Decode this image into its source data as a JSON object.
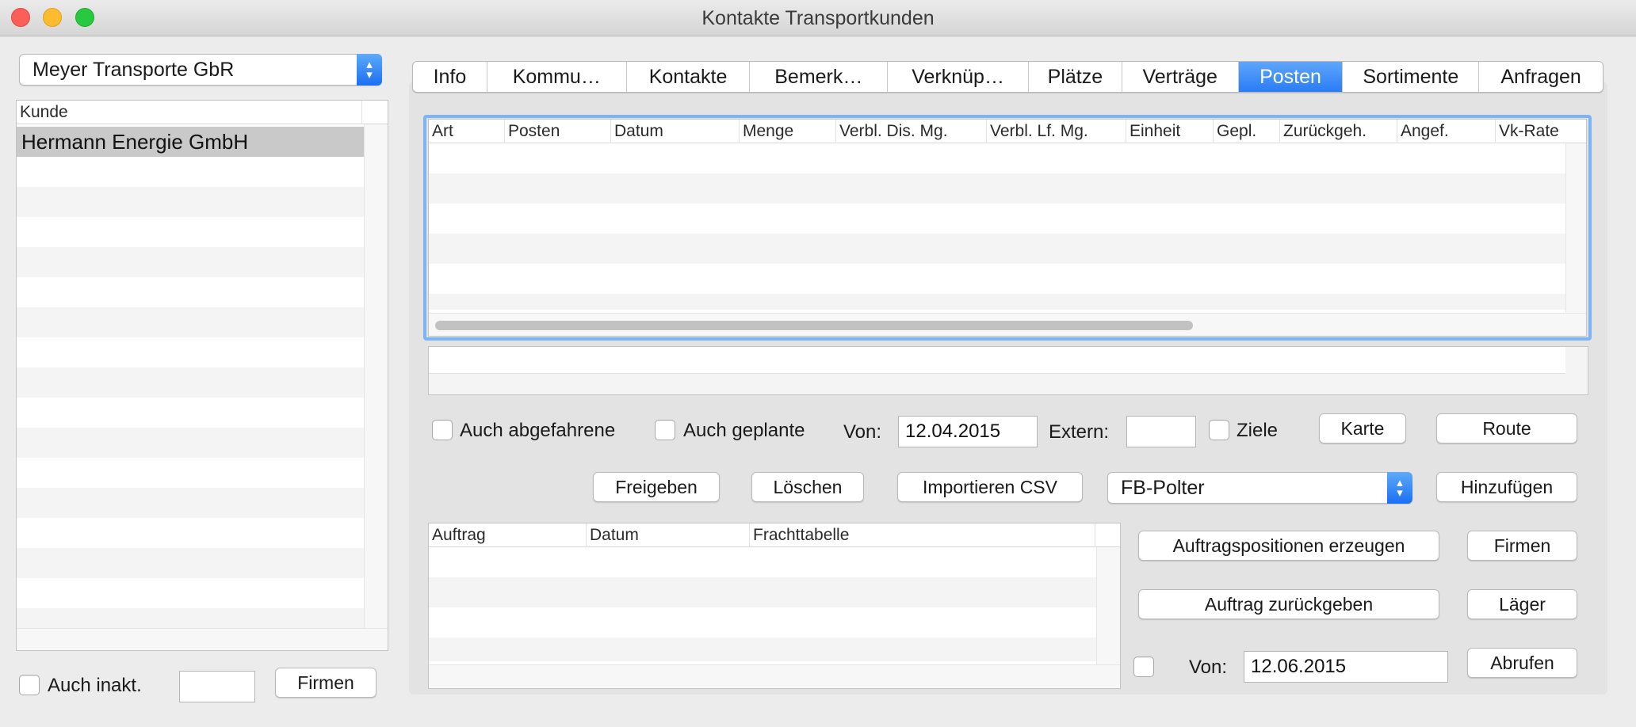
{
  "window": {
    "title": "Kontakte Transportkunden"
  },
  "company_select": {
    "value": "Meyer Transporte GbR"
  },
  "customer_list": {
    "header": "Kunde",
    "rows": [
      "Hermann Energie GmbH"
    ]
  },
  "left_footer": {
    "inactive_label": "Auch inakt.",
    "firms_button": "Firmen"
  },
  "tabs": [
    "Info",
    "Kommu…",
    "Kontakte",
    "Bemerk…",
    "Verknüp…",
    "Plätze",
    "Verträge",
    "Posten",
    "Sortimente",
    "Anfragen"
  ],
  "active_tab": "Posten",
  "posts_table": {
    "columns": [
      "Art",
      "Posten",
      "Datum",
      "Menge",
      "Verbl. Dis. Mg.",
      "Verbl. Lf. Mg.",
      "Einheit",
      "Gepl.",
      "Zurückgeh.",
      "Angef.",
      "Vk-Rate"
    ]
  },
  "filters": {
    "departed_label": "Auch abgefahrene",
    "planned_label": "Auch geplante",
    "from_label": "Von:",
    "from_value": "12.04.2015",
    "extern_label": "Extern:",
    "extern_value": "",
    "targets_label": "Ziele",
    "map_button": "Karte",
    "route_button": "Route"
  },
  "actions": {
    "release_button": "Freigeben",
    "delete_button": "Löschen",
    "import_button": "Importieren CSV",
    "type_select": "FB-Polter",
    "add_button": "Hinzufügen"
  },
  "orders_table": {
    "columns": [
      "Auftrag",
      "Datum",
      "Frachttabelle"
    ]
  },
  "order_actions": {
    "create_positions_button": "Auftragspositionen erzeugen",
    "firms_button": "Firmen",
    "return_order_button": "Auftrag zurückgeben",
    "storage_button": "Läger",
    "from_label": "Von:",
    "from_value": "12.06.2015",
    "fetch_button": "Abrufen"
  },
  "colors": {
    "accent": "#2b7cf5",
    "focus_ring": "#7cb4f7",
    "selected_row": "#c9c9c9"
  }
}
